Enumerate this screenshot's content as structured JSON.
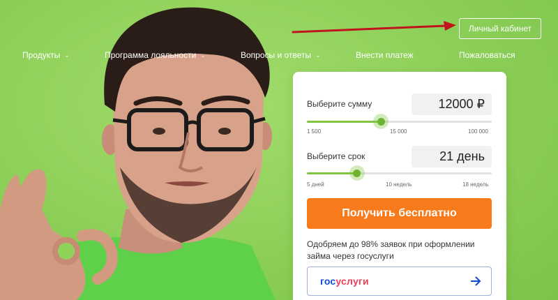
{
  "header": {
    "cabinet_label": "Личный кабинет"
  },
  "nav": {
    "items": [
      {
        "label": "Продукты",
        "dropdown": true
      },
      {
        "label": "Программа лояльности",
        "dropdown": true
      },
      {
        "label": "Вопросы и ответы",
        "dropdown": true
      },
      {
        "label": "Внести платеж",
        "dropdown": false
      },
      {
        "label": "Пожаловаться",
        "dropdown": false
      }
    ],
    "chevron_glyph": "⌄"
  },
  "calculator": {
    "amount": {
      "label": "Выберите сумму",
      "value": "12000 ₽",
      "slider_level": 0.4,
      "ticks": [
        "1 500",
        "15 000",
        "100 000"
      ]
    },
    "term": {
      "label": "Выберите срок",
      "value": "21 день",
      "slider_level": 0.27,
      "ticks": [
        "5 дней",
        "10 недель",
        "18 недель"
      ]
    },
    "cta_label": "Получить бесплатно",
    "note": "Одобряем до 98% заявок при оформлении займа через госуслуги",
    "gosuslugi": {
      "logo_part1": "гос",
      "logo_part2": "услуги",
      "icon": "arrow-right-icon"
    }
  },
  "colors": {
    "background": "#8ed25a",
    "accent_green": "#82c341",
    "cta_orange": "#f77a1b",
    "pointer_red": "#c0141c"
  }
}
